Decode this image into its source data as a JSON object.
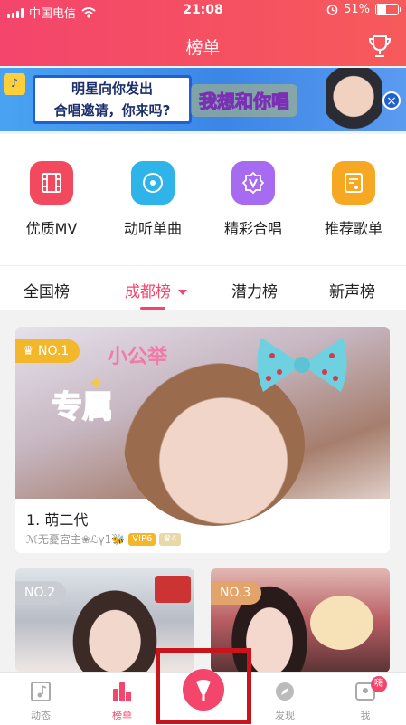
{
  "status": {
    "carrier": "中国电信",
    "time": "21:08",
    "battery": "51%",
    "battery_level": 0.51
  },
  "header": {
    "title": "榜单"
  },
  "banner": {
    "line1": "明星向你发出",
    "line2": "合唱邀请，你来吗?",
    "art_text": "我想和你唱",
    "close": "×"
  },
  "categories": [
    {
      "label": "优质MV",
      "icon": "film-icon",
      "color": "#f2495f"
    },
    {
      "label": "动听单曲",
      "icon": "disc-icon",
      "color": "#2fb4ea"
    },
    {
      "label": "精彩合唱",
      "icon": "v-badge-icon",
      "color": "#a66bf0"
    },
    {
      "label": "推荐歌单",
      "icon": "playlist-icon",
      "color": "#f7a823"
    }
  ],
  "tabs": [
    {
      "label": "全国榜"
    },
    {
      "label": "成都榜"
    },
    {
      "label": "潜力榜"
    },
    {
      "label": "新声榜"
    }
  ],
  "rank1": {
    "badge": "NO.1",
    "title": "1. 萌二代",
    "user": "ℳ无憂宮主❀ℒγ1🐝",
    "vip": "VIP6",
    "crown": "4",
    "overlay_text1": "小公举",
    "overlay_text2": "专属"
  },
  "rank2": {
    "badge": "NO.2",
    "badge_color": "#c9cdd3"
  },
  "rank3": {
    "badge": "NO.3",
    "badge_color": "#e3a46b"
  },
  "tabbar": {
    "items": [
      {
        "label": "动态"
      },
      {
        "label": "榜单"
      },
      {
        "label": ""
      },
      {
        "label": "发现"
      },
      {
        "label": "我"
      }
    ],
    "me_badge": "嗨"
  }
}
